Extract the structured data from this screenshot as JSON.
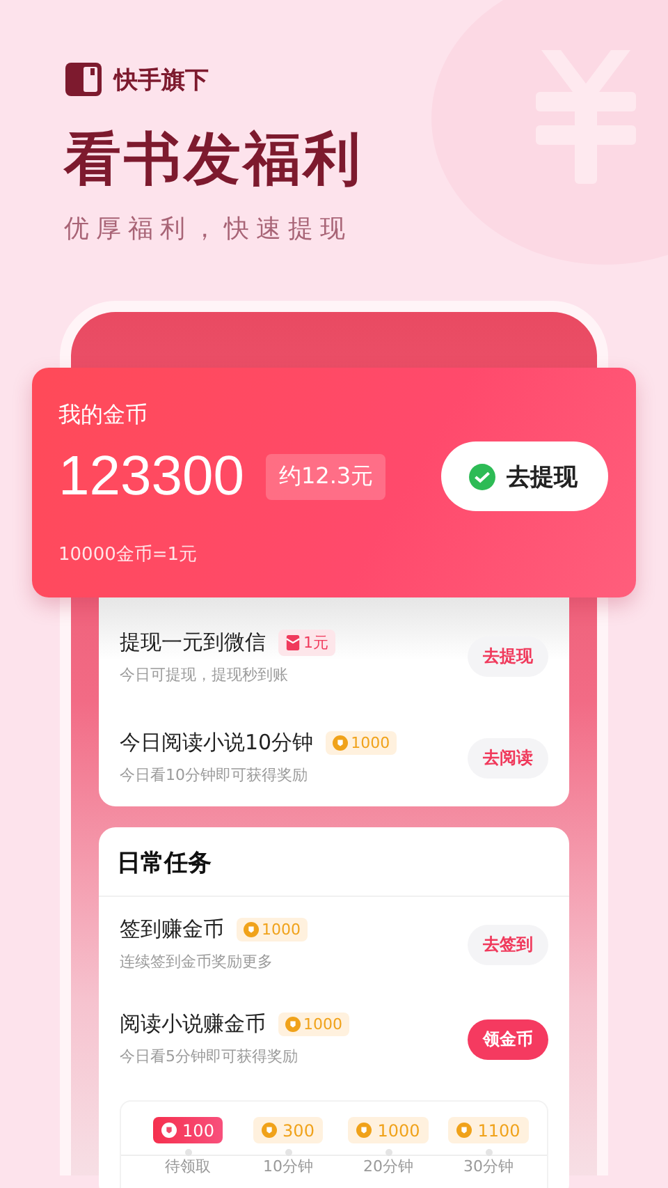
{
  "brand": {
    "label": "快手旗下"
  },
  "headline": "看书发福利",
  "subtitle": "优厚福利，快速提现",
  "coins": {
    "title": "我的金币",
    "amount": "123300",
    "approx": "约12.3元",
    "button": "去提现",
    "rate": "10000金币=1元"
  },
  "top_tasks": [
    {
      "title": "提现一元到微信",
      "kind": "cash",
      "reward": "1元",
      "desc": "今日可提现，提现秒到账",
      "action": "去提现",
      "primary": false
    },
    {
      "title": "今日阅读小说10分钟",
      "kind": "coin",
      "reward": "1000",
      "desc": "今日看10分钟即可获得奖励",
      "action": "去阅读",
      "primary": false
    }
  ],
  "daily": {
    "title": "日常任务",
    "tasks": [
      {
        "title": "签到赚金币",
        "kind": "coin",
        "reward": "1000",
        "desc": "连续签到金币奖励更多",
        "action": "去签到",
        "primary": false
      },
      {
        "title": "阅读小说赚金币",
        "kind": "coin",
        "reward": "1000",
        "desc": "今日看5分钟即可获得奖励",
        "action": "领金币",
        "primary": true
      }
    ],
    "progress": [
      {
        "reward": "100",
        "label": "待领取",
        "selected": true
      },
      {
        "reward": "300",
        "label": "10分钟",
        "selected": false
      },
      {
        "reward": "1000",
        "label": "20分钟",
        "selected": false
      },
      {
        "reward": "1100",
        "label": "30分钟",
        "selected": false
      }
    ]
  }
}
